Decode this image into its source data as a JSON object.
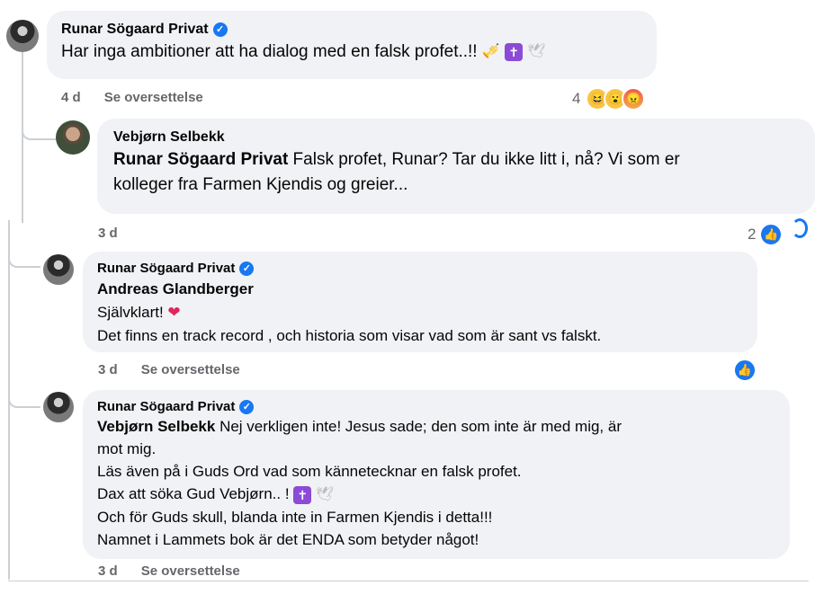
{
  "comments": [
    {
      "author": "Runar Sögaard Privat",
      "text": "Har inga ambitioner att ha dialog med en falsk profet..!!",
      "emojis": [
        "🎺",
        "✝",
        "🕊"
      ],
      "time": "4 d",
      "translate": "Se oversettelse",
      "reaction_count": "4",
      "reactions": [
        "😆",
        "😮",
        "😠"
      ]
    },
    {
      "author": "Vebjørn Selbekk",
      "mention": "Runar Sögaard Privat",
      "text_line1": " Falsk profet, Runar? Tar du ikke litt i, nå? Vi som er",
      "text_line2": "kolleger fra Farmen Kjendis og greier...",
      "time": "3 d",
      "reaction_count": "2",
      "reaction": "👍"
    },
    {
      "author": "Runar Sögaard Privat",
      "mention": "Andreas Glandberger",
      "line1": "Självklart!",
      "heart": "❤",
      "line2": "Det finns en track record , och historia som visar vad som är sant vs falskt.",
      "time": "3 d",
      "translate": "Se oversettelse",
      "reaction": "👍"
    },
    {
      "author": "Runar Sögaard Privat",
      "mention": "Vebjørn Selbekk",
      "line1": " Nej verkligen inte! Jesus sade; den som inte är med mig, är",
      "line2": "mot mig.",
      "line3": "Läs även på i Guds Ord vad som kännetecknar en falsk profet.",
      "line4": "Dax att söka Gud Vebjørn.. !",
      "emojis": [
        "✝",
        "🕊"
      ],
      "line5": "Och för Guds skull, blanda inte in Farmen Kjendis i detta!!!",
      "line6": "Namnet i Lammets bok är det ENDA som betyder något!",
      "time": "3 d",
      "translate": "Se oversettelse"
    }
  ],
  "icons": {
    "verified": "verified-badge-icon",
    "like": "like-reaction-icon",
    "haha": "haha-reaction-icon",
    "wow": "wow-reaction-icon",
    "angry": "angry-reaction-icon"
  },
  "colors": {
    "bubble": "#f0f2f5",
    "meta": "#65676b",
    "accent": "#1877f2"
  }
}
